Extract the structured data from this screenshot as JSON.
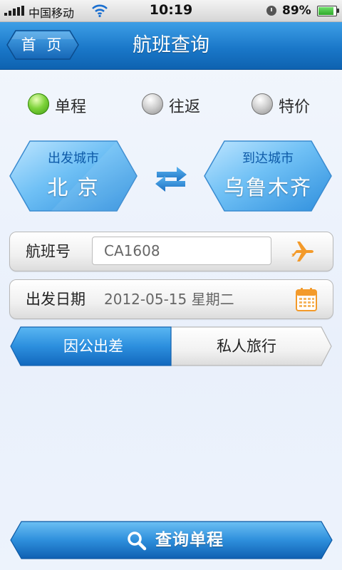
{
  "status_bar": {
    "carrier": "中国移动",
    "time": "10:19",
    "battery_percent": "89%",
    "battery_level": 0.89,
    "icons": [
      "signal-icon",
      "wifi-icon",
      "orientation-lock-icon",
      "battery-icon"
    ]
  },
  "header": {
    "back_label": "首 页",
    "title": "航班查询"
  },
  "trip_types": {
    "options": [
      {
        "label": "单程",
        "selected": true
      },
      {
        "label": "往返",
        "selected": false
      },
      {
        "label": "特价",
        "selected": false
      }
    ]
  },
  "route": {
    "from_label": "出发城市",
    "from_city": "北 京",
    "to_label": "到达城市",
    "to_city": "乌鲁木齐",
    "swap_icon": "swap-arrows-icon"
  },
  "flight": {
    "label": "航班号",
    "value": "CA1608",
    "icon": "airplane-icon"
  },
  "date": {
    "label": "出发日期",
    "value": "2012-05-15  星期二",
    "icon": "calendar-icon"
  },
  "purpose": {
    "options": [
      {
        "label": "因公出差",
        "selected": true
      },
      {
        "label": "私人旅行",
        "selected": false
      }
    ]
  },
  "search": {
    "label": "查询单程",
    "icon": "search-icon"
  },
  "colors": {
    "primary_blue": "#1a78c9",
    "accent_orange": "#f39a2a",
    "selected_green": "#7dd33a"
  }
}
